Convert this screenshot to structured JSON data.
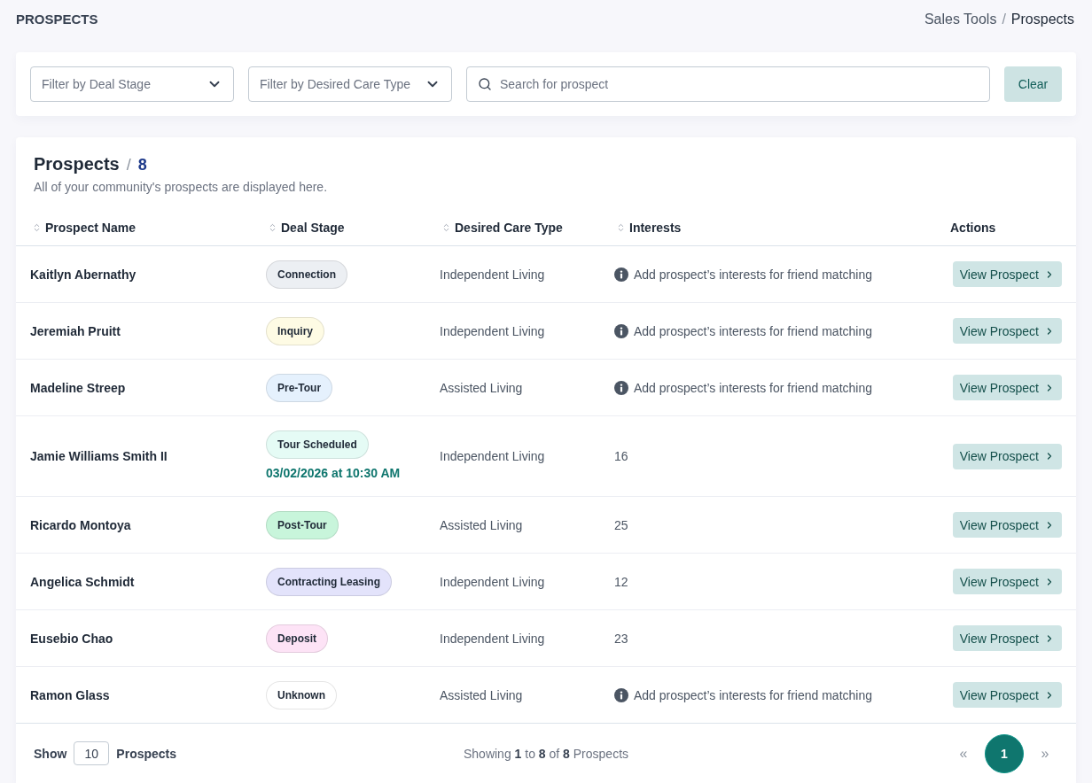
{
  "page_title": "PROSPECTS",
  "breadcrumb": {
    "separator": "/",
    "items": [
      {
        "label": "Sales Tools",
        "current": false
      },
      {
        "label": "Prospects",
        "current": true
      }
    ]
  },
  "filters": {
    "deal_stage": {
      "placeholder": "Filter by Deal Stage"
    },
    "care_type": {
      "placeholder": "Filter by Desired Care Type"
    },
    "search": {
      "placeholder": "Search for prospect"
    },
    "clear_button": "Clear"
  },
  "table_card": {
    "title": "Prospects",
    "separator": "/",
    "count": "8",
    "subtitle": "All of your community's prospects are displayed here."
  },
  "table": {
    "columns": [
      {
        "label": "Prospect Name",
        "sortable": true
      },
      {
        "label": "Deal Stage",
        "sortable": true
      },
      {
        "label": "Desired Care Type",
        "sortable": true
      },
      {
        "label": "Interests",
        "sortable": true
      },
      {
        "label": "Actions",
        "sortable": false
      }
    ],
    "rows": [
      {
        "name": "Kaitlyn Abernathy",
        "stage": {
          "label": "Connection",
          "color": "#eceff3"
        },
        "care_type": "Independent Living",
        "interests": {
          "kind": "hint",
          "text": "Add prospect’s interests for friend matching"
        },
        "action": "View Prospect"
      },
      {
        "name": "Jeremiah Pruitt",
        "stage": {
          "label": "Inquiry",
          "color": "#fefbe4"
        },
        "care_type": "Independent Living",
        "interests": {
          "kind": "hint",
          "text": "Add prospect’s interests for friend matching"
        },
        "action": "View Prospect"
      },
      {
        "name": "Madeline Streep",
        "stage": {
          "label": "Pre-Tour",
          "color": "#e5f1fd"
        },
        "care_type": "Assisted Living",
        "interests": {
          "kind": "hint",
          "text": "Add prospect’s interests for friend matching"
        },
        "action": "View Prospect"
      },
      {
        "name": "Jamie Williams Smith II",
        "stage": {
          "label": "Tour Scheduled",
          "color": "#e5fbf5"
        },
        "tour_time": "03/02/2026 at 10:30 AM",
        "care_type": "Independent Living",
        "interests": {
          "kind": "count",
          "text": "16"
        },
        "action": "View Prospect"
      },
      {
        "name": "Ricardo Montoya",
        "stage": {
          "label": "Post-Tour",
          "color": "#c8f5db"
        },
        "care_type": "Assisted Living",
        "interests": {
          "kind": "count",
          "text": "25"
        },
        "action": "View Prospect"
      },
      {
        "name": "Angelica Schmidt",
        "stage": {
          "label": "Contracting Leasing",
          "color": "#e3e3fb"
        },
        "care_type": "Independent Living",
        "interests": {
          "kind": "count",
          "text": "12"
        },
        "action": "View Prospect"
      },
      {
        "name": "Eusebio Chao",
        "stage": {
          "label": "Deposit",
          "color": "#fde3f6"
        },
        "care_type": "Independent Living",
        "interests": {
          "kind": "count",
          "text": "23"
        },
        "action": "View Prospect"
      },
      {
        "name": "Ramon Glass",
        "stage": {
          "label": "Unknown",
          "color": "#ffffff"
        },
        "care_type": "Assisted Living",
        "interests": {
          "kind": "hint",
          "text": "Add prospect’s interests for friend matching"
        },
        "action": "View Prospect"
      }
    ]
  },
  "footer": {
    "show_label": "Show",
    "page_size": "10",
    "page_size_suffix": "Prospects",
    "summary": "Showing **1** to **8** of **8** Prospects",
    "pagination": {
      "prev": {
        "label": "«",
        "disabled": true
      },
      "pages": [
        {
          "label": "1",
          "selected": true
        }
      ],
      "next": {
        "label": "»",
        "disabled": true
      }
    }
  }
}
